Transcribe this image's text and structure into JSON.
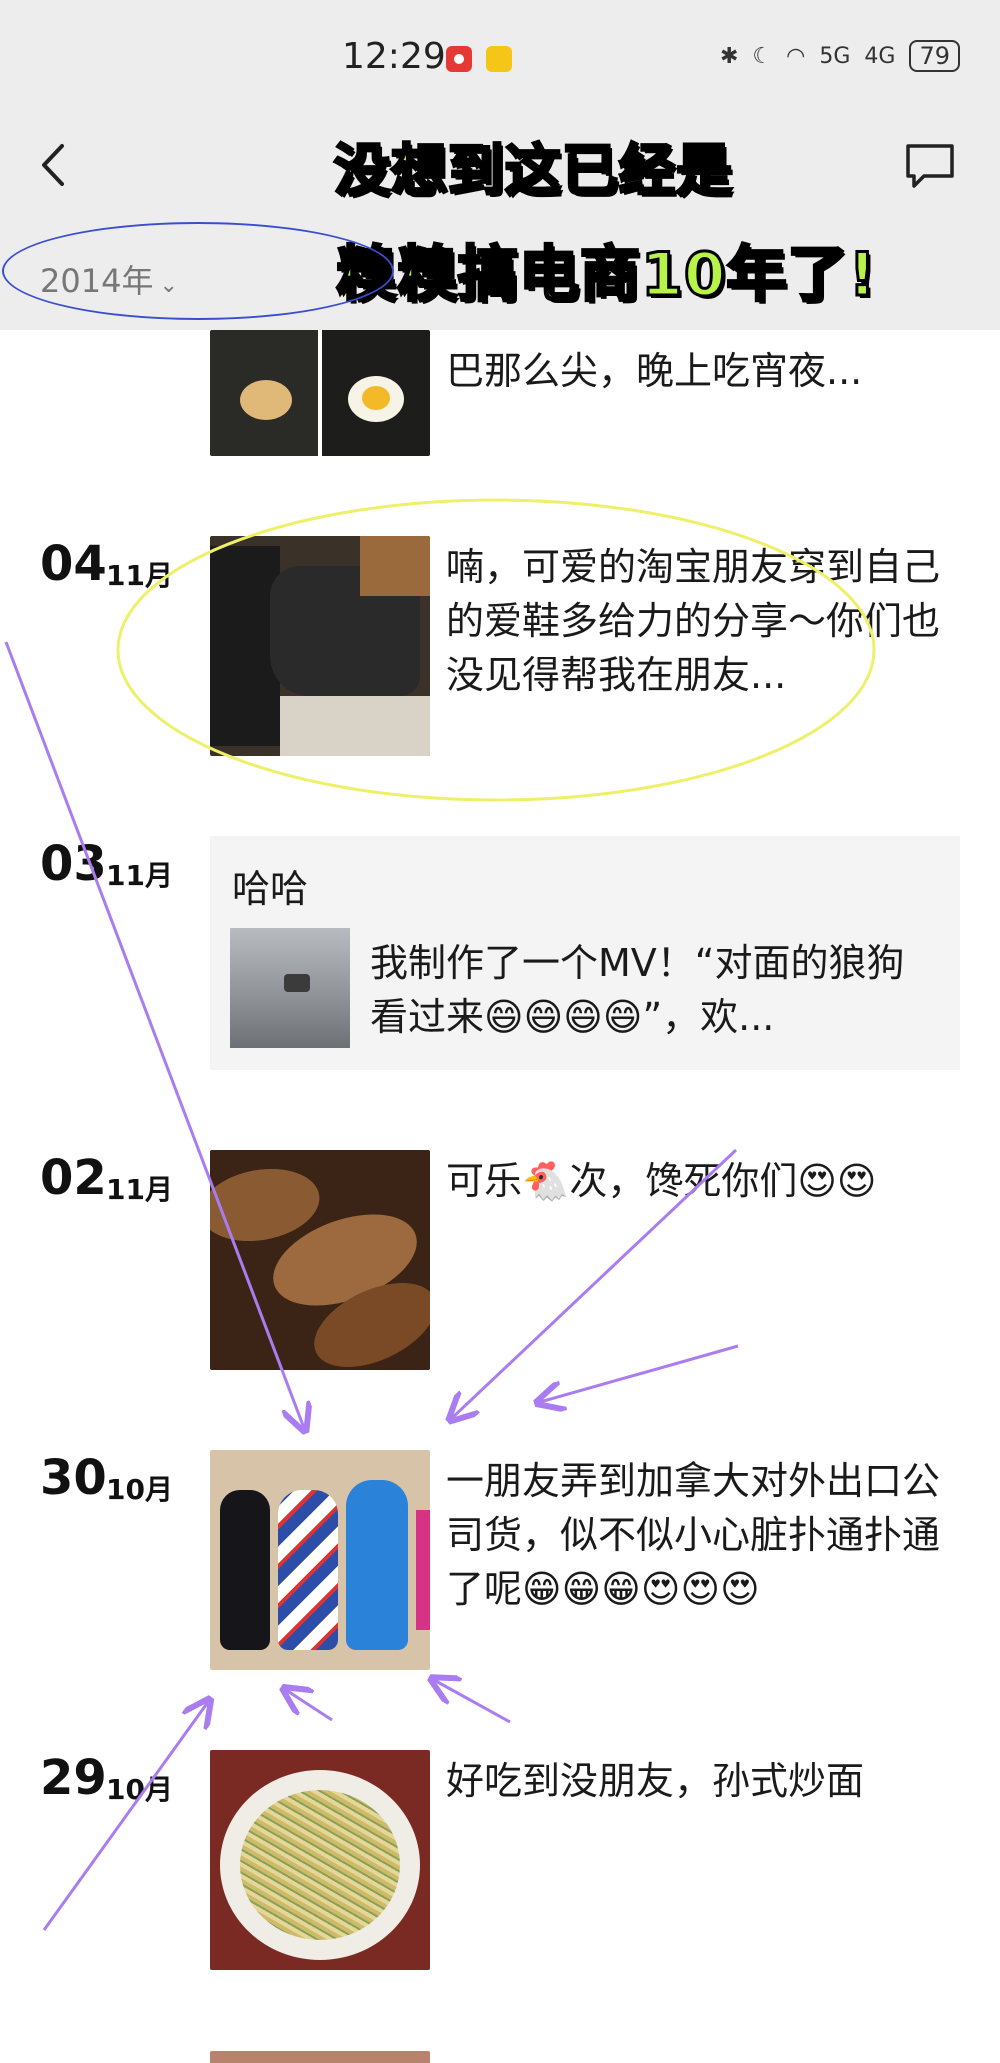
{
  "status_bar": {
    "time": "12:29",
    "battery": "79",
    "net1": "5G",
    "net2": "4G"
  },
  "header": {
    "back_icon": "chevron-left-icon",
    "message_icon": "message-icon"
  },
  "overlay": {
    "line1": "没想到这已经是",
    "line2": "糗糗搞电商10年了!"
  },
  "year_filter": {
    "label": "2014年"
  },
  "entries": [
    {
      "day": "",
      "month": "",
      "text": "巴那么尖，晚上吃宵夜..."
    },
    {
      "day": "04",
      "month": "11月",
      "text": "喃，可爱的淘宝朋友穿到自己的爱鞋多给力的分享～你们也没见得帮我在朋友..."
    },
    {
      "day": "03",
      "month": "11月",
      "share_title": "哈哈",
      "share_text": "我制作了一个MV！“对面的狼狗看过来😄😄😄😄”，欢..."
    },
    {
      "day": "02",
      "month": "11月",
      "text": "可乐🐔次，馋死你们😍😍"
    },
    {
      "day": "30",
      "month": "10月",
      "text": "一朋友弄到加拿大对外出口公司货，似不似小心脏扑通扑通了呢😁😁😁😍😍😍"
    },
    {
      "day": "29",
      "month": "10月",
      "text": "好吃到没朋友，孙式炒面"
    }
  ],
  "colors": {
    "header_bg": "#ededed",
    "overlay_green": "#b7f34b",
    "annotation_purple": "#a97df0",
    "annotation_yellow": "#eef06a",
    "annotation_blue": "#3a4fd0"
  }
}
